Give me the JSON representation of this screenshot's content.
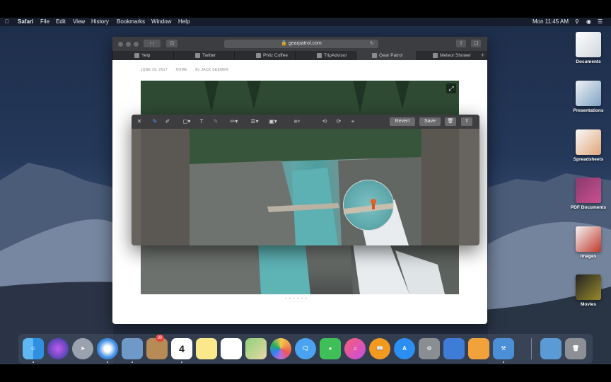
{
  "menubar": {
    "app": "Safari",
    "menus": [
      "File",
      "Edit",
      "View",
      "History",
      "Bookmarks",
      "Window",
      "Help"
    ],
    "clock": "Mon 11:45 AM"
  },
  "safari": {
    "url": "gearpatrol.com",
    "tabs": [
      "Yelp",
      "Twitter",
      "Philz Coffee",
      "TripAdvisor",
      "Gear Patrol",
      "Meteor Shower"
    ],
    "active_tab": "Gear Patrol",
    "article": {
      "date": "JUNE 29, 2017",
      "section": "HOME",
      "byline": "By JACK SEEMER"
    },
    "carousel_dots": "• • • • • •"
  },
  "markup": {
    "revert_label": "Revert",
    "save_label": "Save"
  },
  "desktop_stacks": [
    "Documents",
    "Presentations",
    "Spreadsheets",
    "PDF Documents",
    "Images",
    "Movies"
  ],
  "dock": {
    "calendar_day": "4",
    "calendar_badge": "30",
    "apps": [
      "Finder",
      "Siri",
      "Launchpad",
      "Safari",
      "Photos Stamps",
      "Contacts",
      "Calendar",
      "Notes",
      "Reminders",
      "Maps",
      "Photos",
      "Messages",
      "FaceTime",
      "iTunes",
      "iBooks",
      "App Store",
      "System Preferences",
      "Keynote",
      "Pages",
      "Xcode",
      "Downloads",
      "Trash"
    ]
  }
}
